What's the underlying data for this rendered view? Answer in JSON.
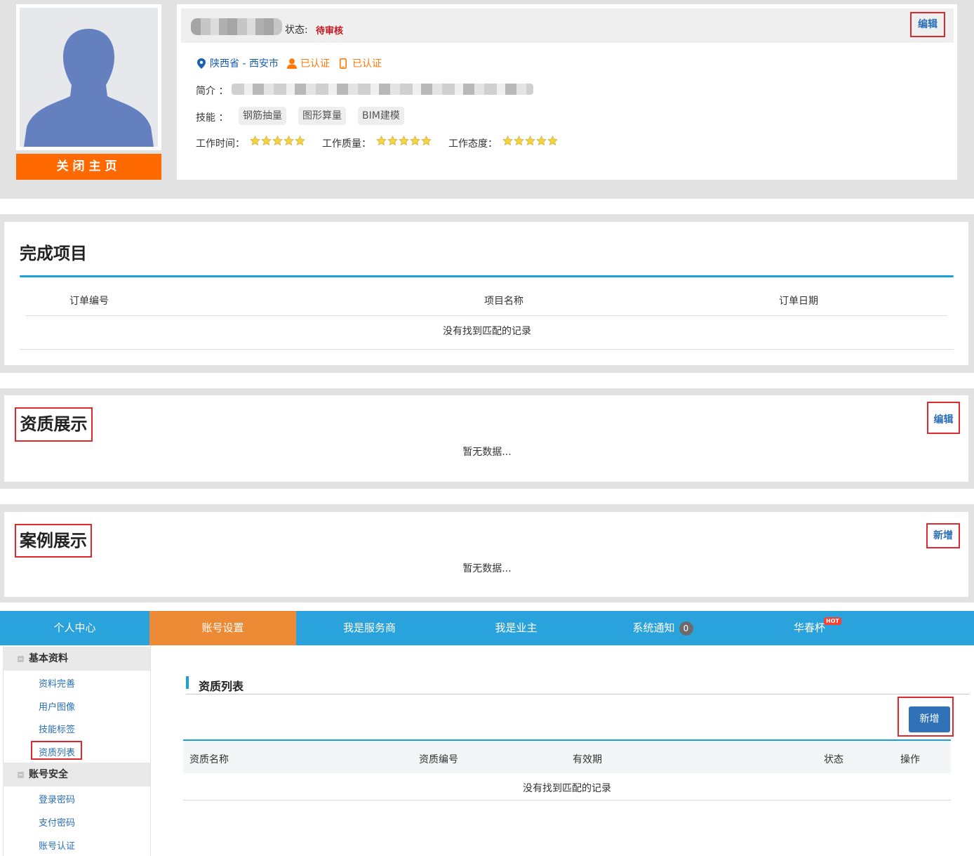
{
  "profile": {
    "close_home": "关闭主页",
    "status_label": "状态:",
    "status_value": "待审核",
    "edit": "编辑",
    "location": "陕西省 - 西安市",
    "verified_identity": "已认证",
    "verified_phone": "已认证",
    "intro_label": "简介 ：",
    "skills_label": "技能 ：",
    "skills": [
      "钢筋抽量",
      "图形算量",
      "BIM建模"
    ],
    "ratings": [
      {
        "label": "工作时间：",
        "stars": 5
      },
      {
        "label": "工作质量：",
        "stars": 5
      },
      {
        "label": "工作态度：",
        "stars": 5
      }
    ]
  },
  "projects": {
    "title": "完成项目",
    "columns": [
      "订单编号",
      "项目名称",
      "订单日期"
    ],
    "empty": "没有找到匹配的记录"
  },
  "qualifications": {
    "title": "资质展示",
    "edit": "编辑",
    "empty": "暂无数据..."
  },
  "cases": {
    "title": "案例展示",
    "add": "新增",
    "empty": "暂无数据..."
  },
  "nav": {
    "items": [
      "个人中心",
      "账号设置",
      "我是服务商",
      "我是业主",
      "系统通知",
      "华春杯"
    ],
    "notify_count": "0",
    "hot": "HOT"
  },
  "sidebar": {
    "group1": "基本资料",
    "group1_items": [
      "资料完善",
      "用户图像",
      "技能标签",
      "资质列表"
    ],
    "group2": "账号安全",
    "group2_items": [
      "登录密码",
      "支付密码",
      "账号认证"
    ]
  },
  "qual_list": {
    "title": "资质列表",
    "add": "新增",
    "columns": [
      "资质名称",
      "资质编号",
      "有效期",
      "状态",
      "操作"
    ],
    "empty": "没有找到匹配的记录"
  },
  "colors": {
    "accent_blue": "#2aa3dd",
    "accent_orange": "#ec8a35",
    "close_orange": "#ff6a00",
    "status_red": "#c8141e",
    "highlight_red": "#e0292d"
  }
}
